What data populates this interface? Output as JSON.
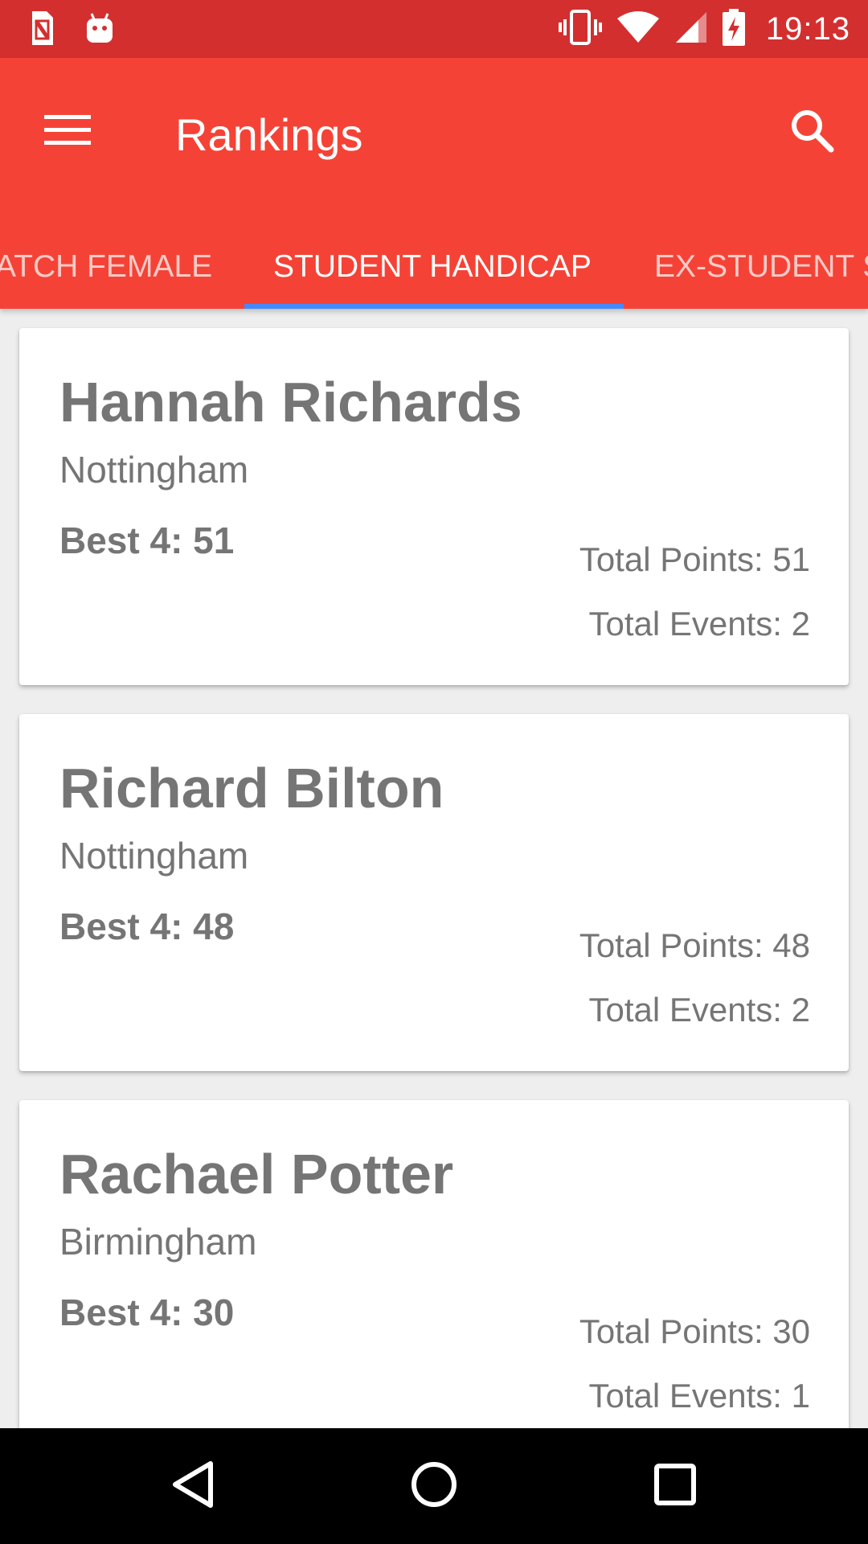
{
  "status_bar": {
    "time": "19:13",
    "icons": [
      "sim-card-icon",
      "android-icon",
      "vibrate-icon",
      "wifi-icon",
      "cell-signal-icon",
      "battery-charging-icon"
    ]
  },
  "app_bar": {
    "title": "Rankings",
    "menu_icon": "menu-icon",
    "search_icon": "search-icon"
  },
  "tabs": [
    {
      "label": "ATCH FEMALE",
      "active": false
    },
    {
      "label": "STUDENT HANDICAP",
      "active": true
    },
    {
      "label": "EX-STUDENT S",
      "active": false
    }
  ],
  "rankings": [
    {
      "name": "Hannah Richards",
      "club": "Nottingham",
      "best4": "Best 4: 51",
      "total_points": "Total Points: 51",
      "total_events": "Total Events: 2"
    },
    {
      "name": "Richard Bilton",
      "club": "Nottingham",
      "best4": "Best 4: 48",
      "total_points": "Total Points: 48",
      "total_events": "Total Events: 2"
    },
    {
      "name": "Rachael Potter",
      "club": "Birmingham",
      "best4": "Best 4: 30",
      "total_points": "Total Points: 30",
      "total_events": "Total Events: 1"
    }
  ],
  "nav_bar": {
    "icons": [
      "back-icon",
      "home-icon",
      "recents-icon"
    ]
  },
  "colors": {
    "status_bar": "#d32f2f",
    "app_bar": "#f44336",
    "tab_indicator": "#448aff",
    "card_text": "#757575"
  }
}
